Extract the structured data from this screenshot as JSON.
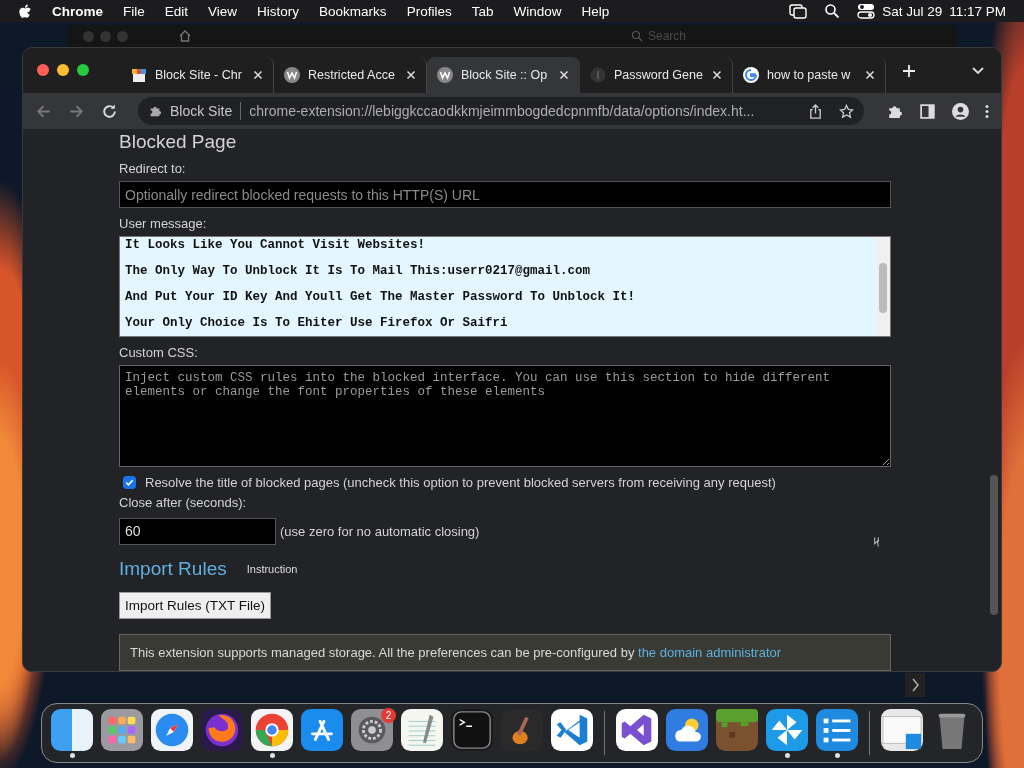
{
  "menu_bar": {
    "app": "Chrome",
    "menus": [
      "File",
      "Edit",
      "View",
      "History",
      "Bookmarks",
      "Profiles",
      "Tab",
      "Window",
      "Help"
    ],
    "date": "Sat Jul 29",
    "time": "11:17 PM"
  },
  "back_window": {
    "search_placeholder": "Search"
  },
  "browser": {
    "tabs": [
      {
        "title": "Block Site - Chr",
        "kind": "blocksite",
        "selected": false
      },
      {
        "title": "Restricted Acce",
        "kind": "w",
        "selected": false
      },
      {
        "title": "Block Site :: Op",
        "kind": "w",
        "selected": true
      },
      {
        "title": "Password Gene",
        "kind": "dark",
        "selected": false
      },
      {
        "title": "how to paste w",
        "kind": "google",
        "selected": false
      }
    ],
    "omnibox": {
      "chip": "Block Site",
      "url": "chrome-extension://lebiggkccaodkkmjeimmbogdedcpnmfb/data/options/index.ht..."
    }
  },
  "page": {
    "section_title": "Blocked Page",
    "redirect": {
      "label": "Redirect to:",
      "placeholder": "Optionally redirect blocked requests to this HTTP(S) URL"
    },
    "user_message": {
      "label": "User message:",
      "lines": [
        "It Looks Like You Cannot Visit Websites!",
        "The Only Way To Unblock It Is To Mail This:userr0217@gmail.com",
        "And Put Your ID Key And Youll Get The Master Password To Unblock It!",
        "Your Only Choice Is To Ehiter Use Firefox Or Saifri"
      ]
    },
    "custom_css": {
      "label": "Custom CSS:",
      "placeholder": "Inject custom CSS rules into the blocked interface. You can use this section to hide different elements or change the font properties of these elements"
    },
    "resolve_title": {
      "label": "Resolve the title of blocked pages (uncheck this option to prevent blocked servers from receiving any request)",
      "checked": true
    },
    "close_after": {
      "label": "Close after (seconds):",
      "value": "60",
      "hint": "(use zero for no automatic closing)"
    },
    "import": {
      "title": "Import Rules",
      "instruction": "Instruction",
      "button": "Import Rules (TXT File)"
    },
    "notice": {
      "text": "This extension supports managed storage. All the preferences can be pre-configured by",
      "link": "the domain administrator"
    }
  },
  "dock": {
    "items": [
      {
        "kind": "finder",
        "running": true
      },
      {
        "kind": "launchpad",
        "running": false
      },
      {
        "kind": "safari",
        "running": false
      },
      {
        "kind": "firefox",
        "running": false
      },
      {
        "kind": "chrome",
        "running": true
      },
      {
        "kind": "appstore",
        "running": false
      },
      {
        "kind": "settings",
        "running": false,
        "badge": "2"
      },
      {
        "kind": "textedit",
        "running": false
      },
      {
        "kind": "terminal",
        "running": false
      },
      {
        "kind": "garageband",
        "running": false
      },
      {
        "kind": "vscode",
        "running": false
      },
      {
        "kind": "separator"
      },
      {
        "kind": "visualstudio",
        "running": false
      },
      {
        "kind": "weather",
        "running": false
      },
      {
        "kind": "minecraft",
        "running": false
      },
      {
        "kind": "pinwheel",
        "running": true
      },
      {
        "kind": "list",
        "running": true
      },
      {
        "kind": "separator"
      },
      {
        "kind": "preview",
        "running": false
      },
      {
        "kind": "trash",
        "running": false
      }
    ]
  }
}
